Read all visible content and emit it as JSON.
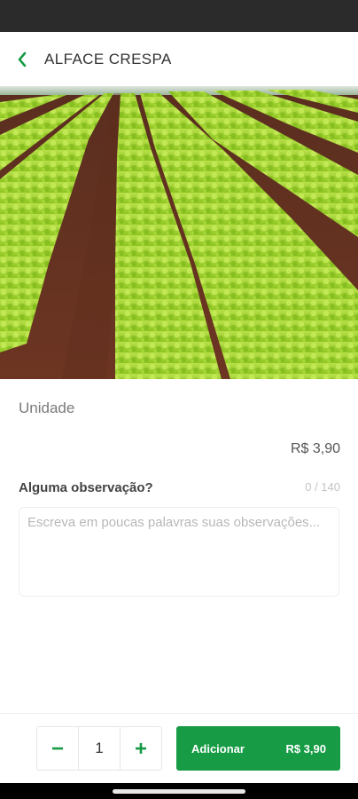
{
  "header": {
    "title": "ALFACE CRESPA",
    "back_icon": "chevron-left-icon",
    "accent_color": "#179b45"
  },
  "product": {
    "image_description_icon": "lettuce-field-photo",
    "unit_label": "Unidade",
    "price": "R$ 3,90"
  },
  "observation": {
    "label": "Alguma observação?",
    "counter": "0 / 140",
    "placeholder": "Escreva em poucas palavras suas observações...",
    "value": ""
  },
  "footer": {
    "quantity": "1",
    "decrement_icon": "minus-icon",
    "increment_icon": "plus-icon",
    "add_label": "Adicionar",
    "add_price": "R$ 3,90"
  }
}
